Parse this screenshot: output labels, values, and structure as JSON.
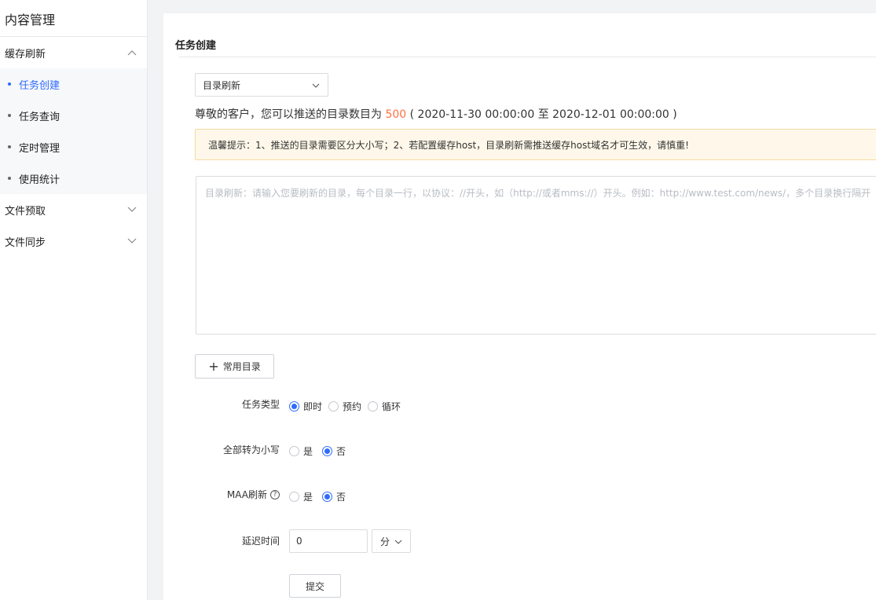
{
  "sidebar": {
    "title": "内容管理",
    "groups": [
      {
        "label": "缓存刷新",
        "expanded": true,
        "items": [
          "任务创建",
          "任务查询",
          "定时管理",
          "使用统计"
        ],
        "active_item": "任务创建"
      },
      {
        "label": "文件预取",
        "expanded": false
      },
      {
        "label": "文件同步",
        "expanded": false
      }
    ]
  },
  "panel": {
    "title": "任务创建",
    "dir_select": "目录刷新",
    "quota": {
      "prefix": "尊敬的客户，您可以推送的目录数目为",
      "count": "500",
      "range": "( 2020-11-30 00:00:00 至 2020-12-01 00:00:00 )"
    },
    "tip": "温馨提示：1、推送的目录需要区分大小写；2、若配置缓存host，目录刷新需推送缓存host域名才可生效，请慎重!",
    "textarea_placeholder": "目录刷新：请输入您要刷新的目录，每个目录一行，以协议：//开头，如（http://或者mms://）开头。例如：http://www.test.com/news/，多个目录换行隔开",
    "add_dir_label": "常用目录",
    "form": {
      "task_type": {
        "label": "任务类型",
        "options": [
          "即时",
          "预约",
          "循环"
        ],
        "selected": "即时"
      },
      "lowercase": {
        "label": "全部转为小写",
        "options": [
          "是",
          "否"
        ],
        "selected": "否"
      },
      "maa": {
        "label": "MAA刷新",
        "options": [
          "是",
          "否"
        ],
        "selected": "否"
      },
      "delay": {
        "label": "延迟时间",
        "value": "0",
        "unit": "分"
      }
    },
    "submit_label": "提交"
  },
  "colors": {
    "accent": "#2f6bff",
    "highlight": "#ff7043",
    "tip_bg": "#fff8ea"
  }
}
